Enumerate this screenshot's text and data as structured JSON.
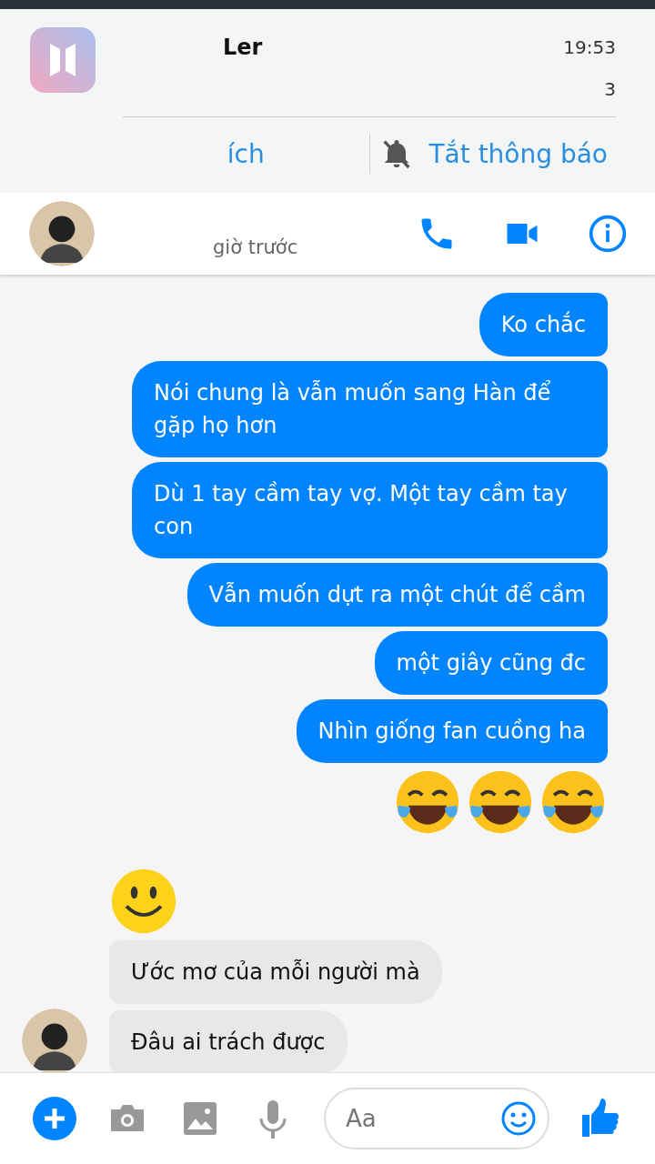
{
  "notification": {
    "title": "Ler",
    "time": "19:53",
    "count": "3",
    "actions": [
      {
        "label": "ích"
      },
      {
        "label": "Tắt thông báo"
      }
    ]
  },
  "header": {
    "status": "giờ trước"
  },
  "sent_messages": [
    {
      "kind": "text",
      "text": "Ko chắc"
    },
    {
      "kind": "text",
      "text": "Nói chung là vẫn muốn sang Hàn để gặp họ hơn"
    },
    {
      "kind": "text",
      "text": "Dù 1 tay cầm tay vợ. Một tay cầm tay con"
    },
    {
      "kind": "text",
      "text": "Vẫn muốn dựt ra một chút để cầm"
    },
    {
      "kind": "text",
      "text": "một giây cũng đc"
    },
    {
      "kind": "text",
      "text": "Nhìn giống fan cuồng ha"
    },
    {
      "kind": "laughs"
    }
  ],
  "received_messages": [
    {
      "kind": "smile"
    },
    {
      "kind": "text",
      "text": "Ước mơ của mỗi người mà"
    },
    {
      "kind": "text",
      "text": "Đâu ai trách được"
    }
  ],
  "composer": {
    "placeholder": "Aa"
  }
}
